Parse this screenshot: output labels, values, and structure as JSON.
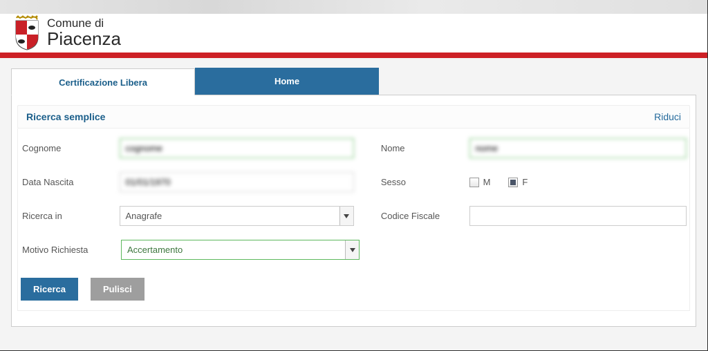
{
  "header": {
    "line1": "Comune di",
    "line2": "Piacenza"
  },
  "tabs": {
    "active": "Certificazione Libera",
    "inactive": "Home"
  },
  "panel": {
    "title": "Ricerca semplice",
    "collapse": "Riduci"
  },
  "labels": {
    "cognome": "Cognome",
    "nome": "Nome",
    "dataNascita": "Data Nascita",
    "sesso": "Sesso",
    "m": "M",
    "f": "F",
    "ricercaIn": "Ricerca in",
    "codiceFiscale": "Codice Fiscale",
    "motivoRichiesta": "Motivo Richiesta"
  },
  "values": {
    "cognome": "cognome",
    "nome": "nome",
    "dataNascita": "01/01/1970",
    "ricercaIn": "Anagrafe",
    "motivoRichiesta": "Accertamento",
    "sessoM": false,
    "sessoF": true
  },
  "buttons": {
    "search": "Ricerca",
    "clear": "Pulisci"
  }
}
